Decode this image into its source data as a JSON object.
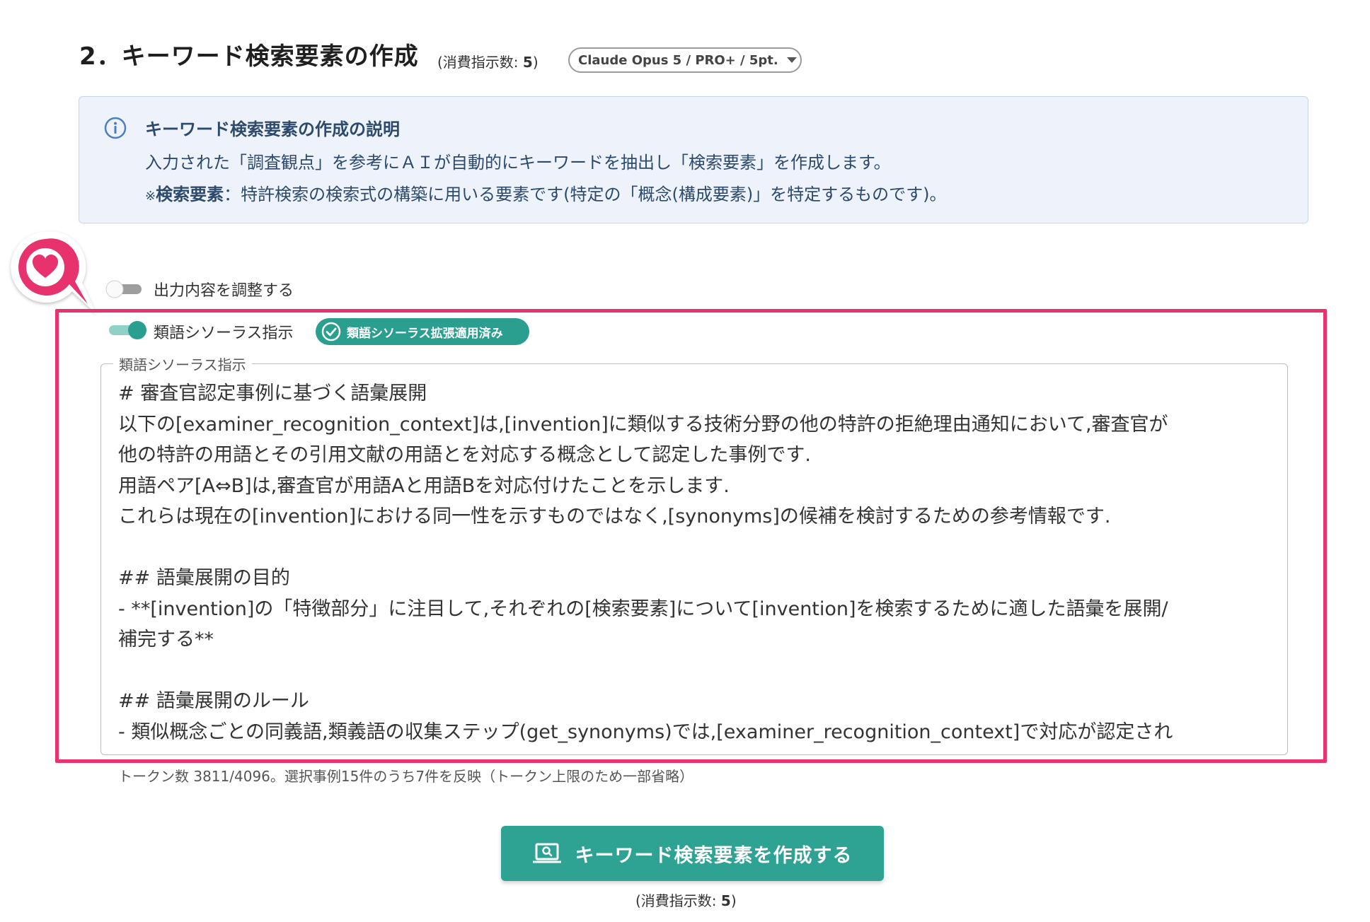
{
  "section": {
    "title": "2．キーワード検索要素の作成",
    "usage_prefix": "(消費指示数: ",
    "usage_value": "5",
    "usage_suffix": ")",
    "model_select": "Claude Opus 5 / PRO+ / 5pt."
  },
  "info": {
    "title": "キーワード検索要素の作成の説明",
    "line1": "入力された「調査観点」を参考にＡＩが自動的にキーワードを抽出し「検索要素」を作成します。",
    "line2_prefix": "※",
    "line2_bold": "検索要素",
    "line2_rest": "：特許検索の検索式の構築に用いる要素です(特定の「概念(構成要素)」を特定するものです)。"
  },
  "toggles": {
    "adjust_output_label": "出力内容を調整する",
    "adjust_output_on": false,
    "thesaurus_label": "類語シソーラス指示",
    "thesaurus_on": true,
    "applied_badge": "類語シソーラス拡張適用済み"
  },
  "thesaurus_field": {
    "legend": "類語シソーラス指示",
    "lines": [
      "# 審査官認定事例に基づく語彙展開",
      "以下の[examiner_recognition_context]は,[invention]に類似する技術分野の他の特許の拒絶理由通知において,審査官が",
      "他の特許の用語とその引用文献の用語とを対応する概念として認定した事例です.",
      "用語ペア[A⇔B]は,審査官が用語Aと用語Bを対応付けたことを示します.",
      "これらは現在の[invention]における同一性を示すものではなく,[synonyms]の候補を検討するための参考情報です.",
      "",
      "## 語彙展開の目的",
      "- **[invention]の「特徴部分」に注目して,それぞれの[検索要素]について[invention]を検索するために適した語彙を展開/",
      "補完する**",
      "",
      "## 語彙展開のルール",
      "- 類似概念ごとの同義語,類義語の収集ステップ(get_synonyms)では,[examiner_recognition_context]で対応が認定され"
    ]
  },
  "token_info": "トークン数 3811/4096。選択事例15件のうち7件を反映（トークン上限のため一部省略）",
  "primary_button": {
    "label": "キーワード検索要素を作成する"
  },
  "footer_usage": {
    "prefix": "(消費指示数: ",
    "value": "5",
    "suffix": ")"
  },
  "colors": {
    "accent_teal": "#2fa393",
    "highlight_pink": "#e8336d",
    "info_bg": "#eef3fb",
    "info_text": "#2d4a6c"
  }
}
